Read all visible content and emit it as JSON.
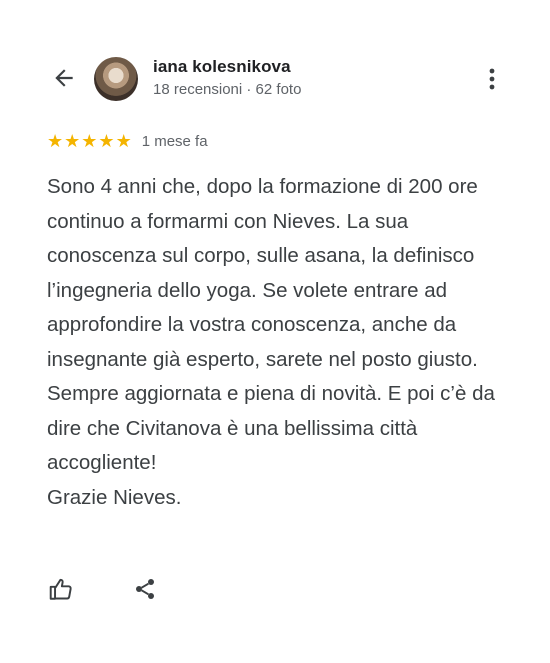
{
  "header": {
    "back_icon": "arrow-back-icon",
    "avatar_icon": "user-avatar",
    "name": "iana kolesnikova",
    "meta": "18 recensioni · 62 foto",
    "menu_icon": "more-vert-icon"
  },
  "rating": {
    "stars": 5,
    "max": 5,
    "star_color": "#f4b400",
    "time": "1 mese fa"
  },
  "review": {
    "paragraphs": [
      "Sono 4 anni che, dopo la formazione di 200 ore continuo a formarmi con Nieves. La sua conoscenza sul corpo, sulle asana, la definisco l’ingegneria dello yoga. Se volete entrare ad approfondire la vostra conoscenza, anche da insegnante già esperto, sarete nel posto giusto.",
      "Sempre aggiornata e piena di novità. E poi c’è da dire che Civitanova è una bellissima città accogliente!",
      "Grazie Nieves."
    ]
  },
  "actions": {
    "like_icon": "thumb-up-icon",
    "share_icon": "share-icon"
  }
}
